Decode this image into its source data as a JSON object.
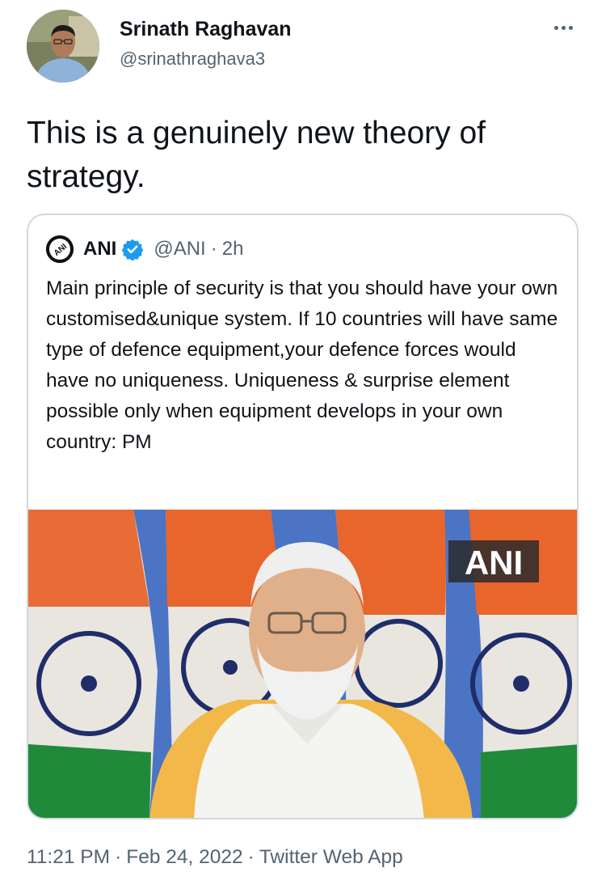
{
  "tweet": {
    "author_name": "Srinath Raghavan",
    "author_handle": "@srinathraghava3",
    "text": "This is a genuinely new theory of strategy.",
    "time": "11:21 PM",
    "date": "Feb 24, 2022",
    "source": "Twitter Web App",
    "separator": "·"
  },
  "quoted": {
    "name": "ANI",
    "handle": "@ANI",
    "separator": "·",
    "age": "2h",
    "text": "Main principle of security is that you should have your own customised&unique system. If 10 countries will have same type of defence equipment,your defence forces would have no uniqueness. Uniqueness & surprise element possible only when equipment develops in your own country: PM",
    "media_watermark": "ANI",
    "logo_text": "ANI"
  },
  "icons": {
    "more": "more-horizontal-icon",
    "verified": "verified-badge-icon"
  },
  "colors": {
    "text_primary": "#0f1419",
    "text_secondary": "#536471",
    "verified_blue": "#1d9bf0",
    "border": "#cfd9de",
    "flag_saffron": "#e8652c",
    "flag_green": "#1f8a3a",
    "backdrop_blue": "#4c74c4"
  }
}
